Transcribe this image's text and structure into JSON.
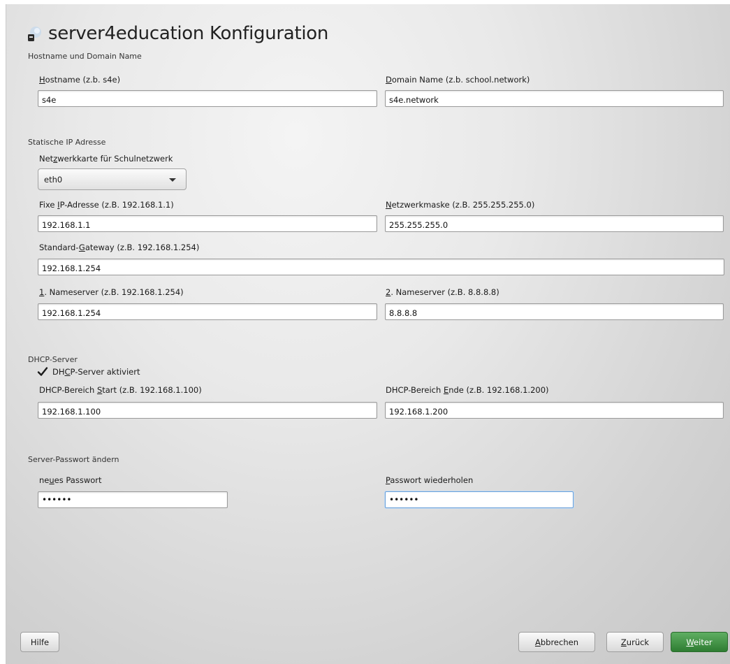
{
  "header": {
    "title": "server4education Konfiguration",
    "icon": "server-icon"
  },
  "sections": {
    "hostname": "Hostname und Domain Name",
    "ip": "Statische IP Adresse",
    "dhcp": "DHCP-Server",
    "password": "Server-Passwort ändern"
  },
  "hostname": {
    "label_u": "H",
    "label_rest": "ostname (z.b. s4e)",
    "value": "s4e"
  },
  "domain": {
    "label_u": "D",
    "label_rest": "omain Name (z.b. school.network)",
    "value": "s4e.network"
  },
  "nic": {
    "label_pre": "Net",
    "label_u": "z",
    "label_rest": "werkkarte für Schulnetzwerk",
    "selected": "eth0"
  },
  "fixed_ip": {
    "label_pre": "Fixe ",
    "label_u": "I",
    "label_rest": "P-Adresse (z.B. 192.168.1.1)",
    "value": "192.168.1.1"
  },
  "netmask": {
    "label_u": "N",
    "label_rest": "etzwerkmaske (z.B. 255.255.255.0)",
    "value": "255.255.255.0"
  },
  "gateway": {
    "label_pre": "Standard-",
    "label_u": "G",
    "label_rest": "ateway (z.B. 192.168.1.254)",
    "value": "192.168.1.254"
  },
  "ns1": {
    "label_u": "1",
    "label_rest": ". Nameserver (z.B. 192.168.1.254)",
    "value": "192.168.1.254"
  },
  "ns2": {
    "label_u": "2",
    "label_rest": ". Nameserver (z.B. 8.8.8.8)",
    "value": "8.8.8.8"
  },
  "dhcp_enabled": {
    "label_pre": "DH",
    "label_u": "C",
    "label_rest": "P-Server aktiviert",
    "checked": true
  },
  "dhcp_start": {
    "label_pre": "DHCP-Bereich ",
    "label_u": "S",
    "label_rest": "tart (z.B. 192.168.1.100)",
    "value": "192.168.1.100"
  },
  "dhcp_end": {
    "label_pre": "DHCP-Bereich ",
    "label_u": "E",
    "label_rest": "nde (z.B. 192.168.1.200)",
    "value": "192.168.1.200"
  },
  "new_password": {
    "label_pre": "ne",
    "label_u": "u",
    "label_rest": "es Passwort",
    "value": "••••••"
  },
  "repeat_password": {
    "label_u": "P",
    "label_rest": "asswort wiederholen",
    "value": "••••••"
  },
  "buttons": {
    "help": "Hilfe",
    "cancel_u": "A",
    "cancel_rest": "bbrechen",
    "back_u": "Z",
    "back_rest": "urück",
    "next_u": "W",
    "next_rest": "eiter"
  },
  "colors": {
    "accent_green": "#2e7d32",
    "focus_blue": "#6aa0d8"
  }
}
